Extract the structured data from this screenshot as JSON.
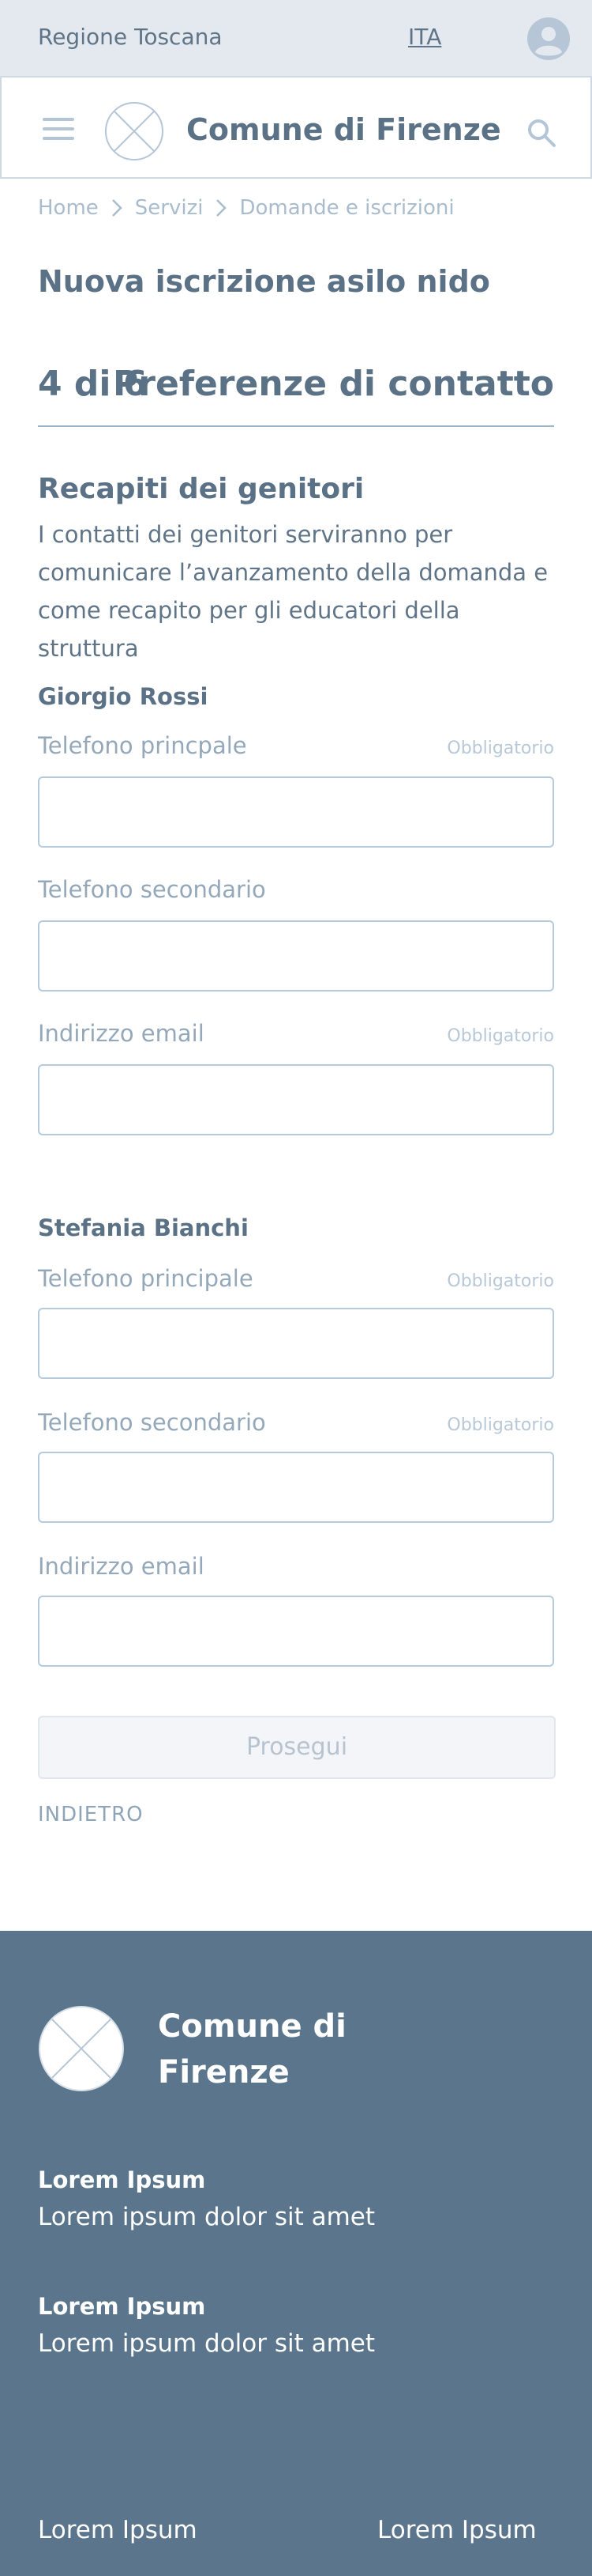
{
  "topbar": {
    "region": "Regione Toscana",
    "language": "ITA",
    "user_icon": "user-avatar-icon"
  },
  "header": {
    "menu_icon": "hamburger-menu-icon",
    "logo_icon": "logo-placeholder-icon",
    "title": "Comune di Firenze",
    "search_icon": "search-icon"
  },
  "breadcrumb": {
    "items": [
      "Home",
      "Servizi",
      "Domande e iscrizioni"
    ]
  },
  "page": {
    "title": "Nuova iscrizione asilo nido"
  },
  "step": {
    "indicator": "4 di 6",
    "title": "Preferenze di contatto"
  },
  "section": {
    "title": "Recapiti dei genitori",
    "description": "I contatti dei genitori serviranno per comunicare l’avanzamento della domanda e come recapito per gli educatori della struttura"
  },
  "parents": [
    {
      "name": "Giorgio Rossi",
      "fields": [
        {
          "label": "Telefono princpale",
          "required": "Obbligatorio",
          "value": ""
        },
        {
          "label": "Telefono secondario",
          "required": "",
          "value": ""
        },
        {
          "label": "Indirizzo email",
          "required": "Obbligatorio",
          "value": ""
        }
      ]
    },
    {
      "name": "Stefania Bianchi",
      "fields": [
        {
          "label": "Telefono principale",
          "required": "Obbligatorio",
          "value": ""
        },
        {
          "label": "Telefono secondario",
          "required": "Obbligatorio",
          "value": ""
        },
        {
          "label": "Indirizzo email",
          "required": "",
          "value": ""
        }
      ]
    }
  ],
  "actions": {
    "next": "Prosegui",
    "back": "INDIETRO"
  },
  "footer": {
    "logo_icon": "logo-placeholder-icon",
    "title": "Comune di Firenze",
    "blocks": [
      {
        "heading": "Lorem Ipsum",
        "text": "Lorem ipsum dolor sit amet"
      },
      {
        "heading": "Lorem Ipsum",
        "text": "Lorem ipsum dolor sit amet"
      }
    ],
    "links": [
      "Lorem Ipsum",
      "Lorem Ipsum"
    ]
  },
  "colors": {
    "topbar_bg": "#e4e9f0",
    "primary_text": "#5a7186",
    "footer_bg": "#5b768c"
  }
}
